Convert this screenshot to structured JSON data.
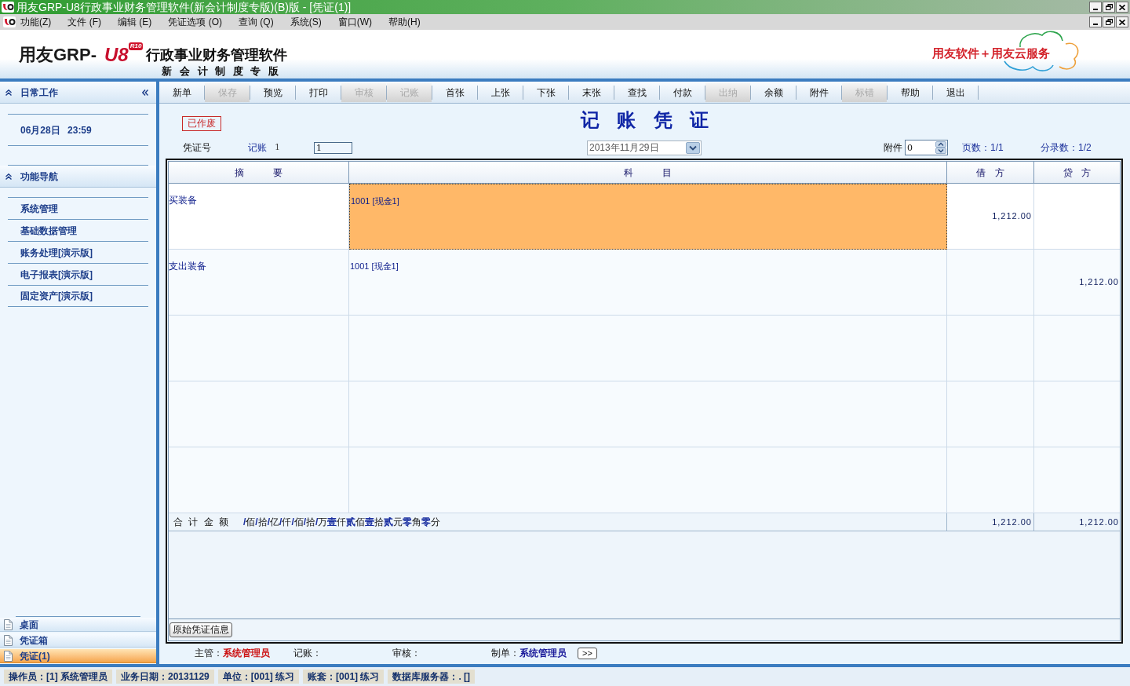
{
  "window": {
    "title": "用友GRP-U8行政事业财务管理软件(新会计制度专版)(B)版 - [凭证(1)]"
  },
  "menu_bar": {
    "items": [
      "功能(Z)",
      "文件 (F)",
      "编辑 (E)",
      "凭证选项 (O)",
      "查询 (Q)",
      "系统(S)",
      "窗口(W)",
      "帮助(H)"
    ]
  },
  "banner": {
    "logo": {
      "brand": "用友GRP-",
      "mark": "U8",
      "badge": "R10",
      "title": "行政事业财务管理软件",
      "subtitle": "新 会 计 制 度 专 版"
    },
    "slogan": "用友软件＋用友云服务"
  },
  "sidebar": {
    "daily_work": {
      "title": "日常工作",
      "expanded": true,
      "date_time": "06月28日 23:59"
    },
    "navigation": {
      "title": "功能导航",
      "expanded": true,
      "items": [
        "系统管理",
        "基础数据管理",
        "账务处理[演示版]",
        "电子报表[演示版]",
        "固定资产[演示版]"
      ]
    },
    "tabs": [
      {
        "label": "桌面",
        "selected": false
      },
      {
        "label": "凭证箱",
        "selected": false
      },
      {
        "label": "凭证(1)",
        "selected": true
      }
    ]
  },
  "toolbar": {
    "buttons": [
      {
        "label": "新单",
        "disabled": false
      },
      {
        "label": "保存",
        "disabled": true
      },
      {
        "label": "预览",
        "disabled": false
      },
      {
        "label": "打印",
        "disabled": false
      },
      {
        "label": "审核",
        "disabled": true
      },
      {
        "label": "记账",
        "disabled": true
      },
      {
        "label": "首张",
        "disabled": false
      },
      {
        "label": "上张",
        "disabled": false
      },
      {
        "label": "下张",
        "disabled": false
      },
      {
        "label": "末张",
        "disabled": false
      },
      {
        "label": "查找",
        "disabled": false
      },
      {
        "label": "付款",
        "disabled": false
      },
      {
        "label": "出纳",
        "disabled": true
      },
      {
        "label": "余额",
        "disabled": false
      },
      {
        "label": "附件",
        "disabled": false
      },
      {
        "label": "标错",
        "disabled": true
      },
      {
        "label": "帮助",
        "disabled": false
      },
      {
        "label": "退出",
        "disabled": false
      }
    ]
  },
  "voucher": {
    "status_stamp": "已作废",
    "title": "记 账 凭 证",
    "number_label": "凭证号",
    "type": "记账",
    "type_number": "1",
    "number_value": "1",
    "date": "2013年11月29日",
    "attachments_label": "附件",
    "attachments_value": "0",
    "pages": "页数：1/1",
    "entry_count": "分录数：1/2",
    "table": {
      "columns": [
        "摘 要",
        "科 目",
        "借 方",
        "贷 方"
      ],
      "rows": [
        {
          "summary": "买装备",
          "account": "1001 [现金1]",
          "debit": "1,212.00",
          "selected": true
        },
        {
          "summary": "支出装备",
          "account": "1001 [现金1]",
          "credit": "1,212.00",
          "selected": false
        }
      ],
      "total": {
        "label": "合 计 金 额",
        "amount_in_words": [
          {
            "digit": "/",
            "unit": "佰"
          },
          {
            "digit": "/",
            "unit": "拾"
          },
          {
            "digit": "/",
            "unit": "亿"
          },
          {
            "digit": "/",
            "unit": "仟"
          },
          {
            "digit": "/",
            "unit": "佰"
          },
          {
            "digit": "/",
            "unit": "拾"
          },
          {
            "digit": "/",
            "unit": "万"
          },
          {
            "digit": "壹",
            "unit": "仟"
          },
          {
            "digit": "贰",
            "unit": "佰"
          },
          {
            "digit": "壹",
            "unit": "拾"
          },
          {
            "digit": "贰",
            "unit": "元"
          },
          {
            "digit": "零",
            "unit": "角"
          },
          {
            "digit": "零",
            "unit": "分"
          }
        ],
        "debit": "1,212.00",
        "credit": "1,212.00"
      }
    },
    "source_button": "原始凭证信息",
    "signatures": [
      {
        "label": "主管：",
        "value": "系统管理员",
        "color": "#cc1111"
      },
      {
        "label": "记账："
      },
      {
        "label": "审核："
      },
      {
        "label": "制单：",
        "value": "系统管理员",
        "color": "#1a1a9a"
      }
    ],
    "more_button": ">>"
  },
  "status_bar": {
    "fields": [
      "操作员：[1] 系统管理员",
      "业务日期：20131129",
      "单位：[001] 练习",
      "账套：[001] 练习",
      "数据库服务器：. []"
    ]
  }
}
